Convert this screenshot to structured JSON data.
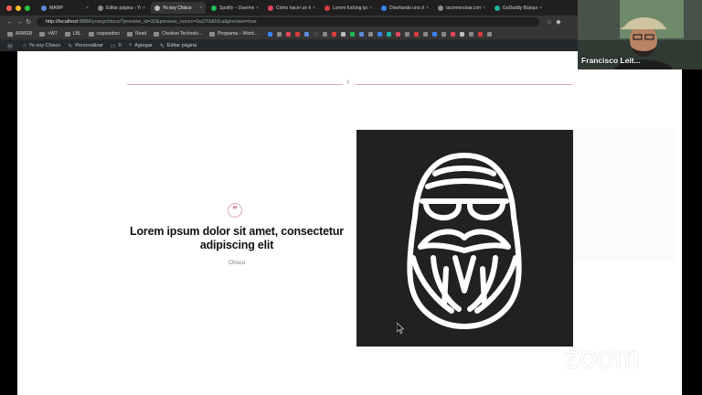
{
  "browser": {
    "tabs": [
      {
        "label": "MAMP",
        "color": "#5b8ad8",
        "active": false
      },
      {
        "label": "Editar página ‹ Yo soy",
        "color": "#888888",
        "active": false
      },
      {
        "label": "Yo soy Chisco",
        "color": "#bbbbbb",
        "active": true
      },
      {
        "label": "Spotify – Duerme",
        "color": "#1db954",
        "active": false
      },
      {
        "label": "Cómo hacer un logo",
        "color": "#e0465c",
        "active": false
      },
      {
        "label": "Lorem fucking ipsum",
        "color": "#d93b3b",
        "active": false
      },
      {
        "label": "Diseñando uno de",
        "color": "#3b82f6",
        "active": false
      },
      {
        "label": "tacomercioar.com",
        "color": "#888888",
        "active": false
      },
      {
        "label": "GoDaddy Búsqueda",
        "color": "#1bb0a0",
        "active": false
      }
    ],
    "url_host": "http://localhost",
    "url_rest": ":8888/yosoychisco/?preview_id=32&preview_nonce=0a370d0d1a&preview=true",
    "bookmarks": [
      "ARWEB",
      "<W7",
      "LBL",
      "csspandocr",
      "Read",
      "Creative Technolo...",
      "Programa – Word..."
    ]
  },
  "wp_admin": {
    "site": "Yo soy Chisco",
    "customize": "Personalizar",
    "comments": "0",
    "add": "Agregar",
    "edit": "Editar página"
  },
  "content": {
    "separator": "//",
    "quote_mark": "”",
    "quote": "Lorem ipsum dolor sit amet, consectetur adipiscing elit",
    "author": "Chisco"
  },
  "zoom": {
    "participant_name": "Francisco Leit...",
    "watermark": "zoom"
  },
  "colors": {
    "accent": "#b03a68",
    "separator": "#d9a9bd",
    "image_bg": "#212121"
  }
}
